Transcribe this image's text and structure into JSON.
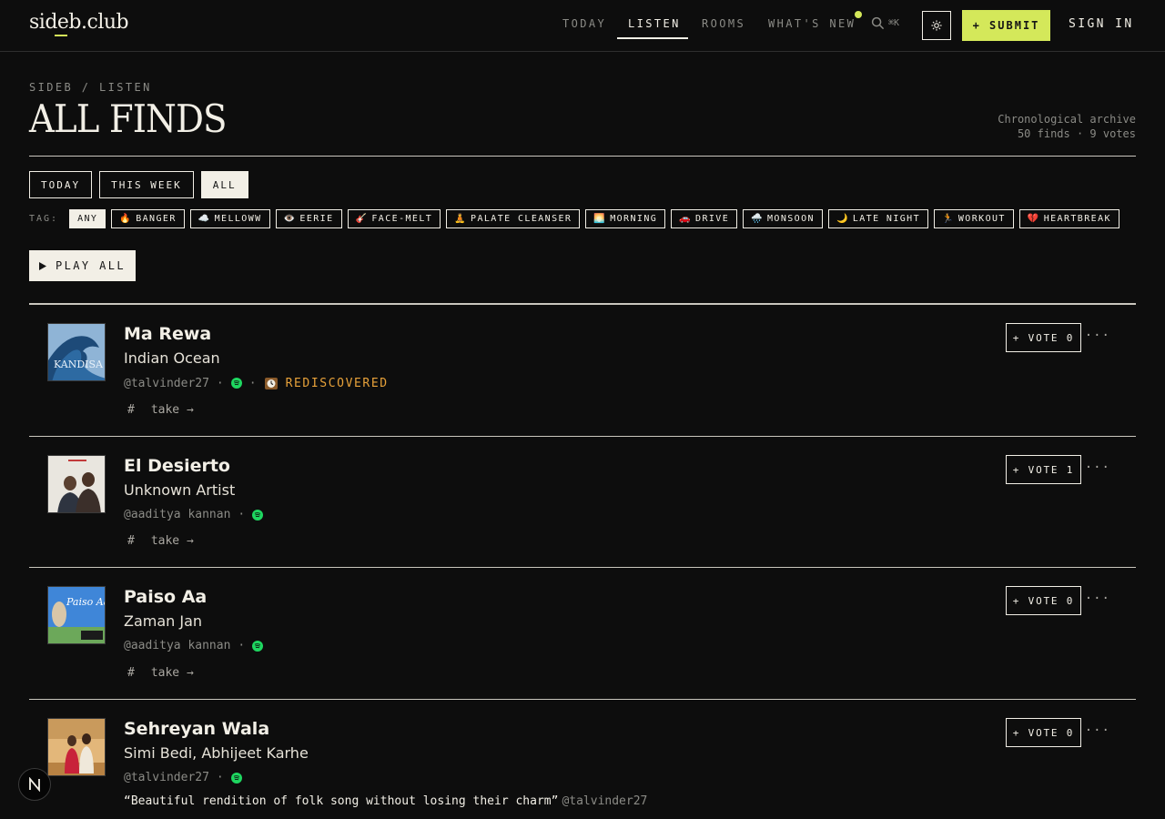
{
  "header": {
    "logo": "sideb.club",
    "nav": [
      "TODAY",
      "LISTEN",
      "ROOMS",
      "WHAT'S NEW"
    ],
    "search_shortcut": "⌘K",
    "submit_label": "+ SUBMIT",
    "signin_label": "SIGN IN",
    "accent_color": "#d4e85a"
  },
  "page": {
    "breadcrumb": "SIDEB / LISTEN",
    "title": "ALL FINDS",
    "archive_label": "Chronological archive",
    "archive_stats": "50 finds · 9 votes"
  },
  "filters": {
    "time": [
      "TODAY",
      "THIS WEEK",
      "ALL"
    ],
    "active_time": "ALL",
    "tag_label": "TAG:",
    "tags": [
      {
        "emoji": "",
        "label": "ANY"
      },
      {
        "emoji": "🔥",
        "label": "BANGER"
      },
      {
        "emoji": "☁️",
        "label": "MELLOWW"
      },
      {
        "emoji": "👁️",
        "label": "EERIE"
      },
      {
        "emoji": "🎸",
        "label": "FACE-MELT"
      },
      {
        "emoji": "🧘",
        "label": "PALATE CLEANSER"
      },
      {
        "emoji": "🌅",
        "label": "MORNING"
      },
      {
        "emoji": "🚗",
        "label": "DRIVE"
      },
      {
        "emoji": "🌧️",
        "label": "MONSOON"
      },
      {
        "emoji": "🌙",
        "label": "LATE NIGHT"
      },
      {
        "emoji": "🏃",
        "label": "WORKOUT"
      },
      {
        "emoji": "💔",
        "label": "HEARTBREAK"
      }
    ],
    "active_tag": "ANY"
  },
  "play_all_label": "PLAY ALL",
  "tracks": [
    {
      "title": "Ma Rewa",
      "artist": "Indian Ocean",
      "user": "@talvinder27",
      "badge": "REDISCOVERED",
      "vote": "+ VOTE 0",
      "take": "take →",
      "art_label": "KANDISA"
    },
    {
      "title": "El Desierto",
      "artist": "Unknown Artist",
      "user": "@aaditya kannan",
      "badge": "",
      "vote": "+ VOTE 1",
      "take": "take →",
      "art_label": ""
    },
    {
      "title": "Paiso Aa",
      "artist": "Zaman Jan",
      "user": "@aaditya kannan",
      "badge": "",
      "vote": "+ VOTE 0",
      "take": "take →",
      "art_label": "Paiso Aa"
    },
    {
      "title": "Sehreyan Wala",
      "artist": "Simi Bedi, Abhijeet Karhe",
      "user": "@talvinder27",
      "badge": "",
      "vote": "+ VOTE 0",
      "take": "",
      "art_label": "",
      "quote": "“Beautiful rendition of folk song without losing their charm”",
      "quote_by": "@talvinder27"
    }
  ]
}
